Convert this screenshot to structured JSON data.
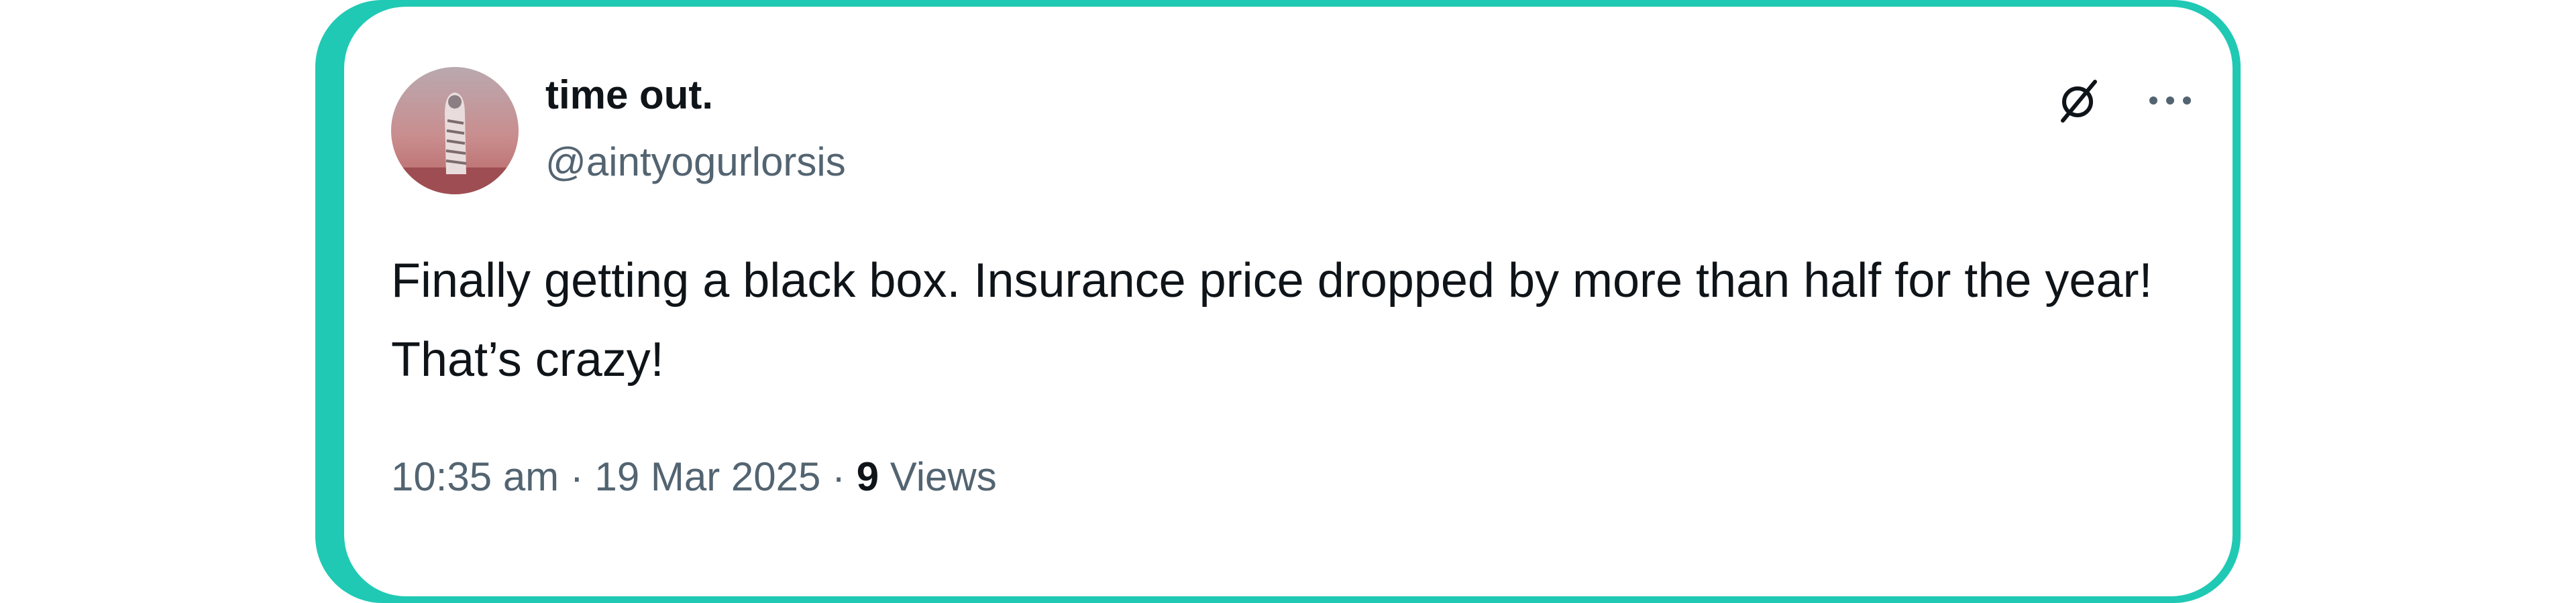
{
  "author": {
    "display_name": "time out.",
    "handle": "@aintyogurlorsis"
  },
  "tweet": {
    "text": "Finally getting a black box. Insurance price dropped by more than half for the year! That’s crazy!",
    "time": "10:35 am",
    "separator": "·",
    "date": "19 Mar 2025",
    "views_count": "9",
    "views_label": "Views"
  },
  "icons": {
    "brand": "x-logo-icon",
    "more": "more-options-icon"
  },
  "colors": {
    "frame_accent": "#20c9b4",
    "primary_text": "#0f1419",
    "secondary_text": "#536471"
  }
}
